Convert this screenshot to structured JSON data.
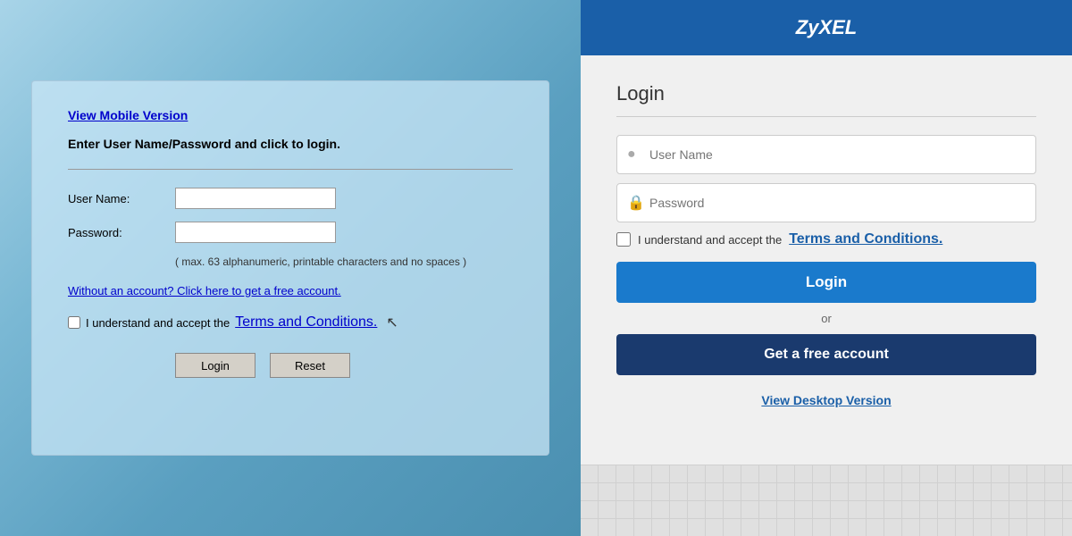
{
  "left": {
    "view_mobile_label": "View Mobile Version",
    "instruction": "Enter User Name/Password and click to login.",
    "username_label": "User Name:",
    "password_label": "Password:",
    "password_hint": "( max. 63 alphanumeric, printable characters and no spaces )",
    "free_account_link": "Without an account? Click here to get a free account.",
    "terms_text": "I understand and accept the ",
    "terms_link": "Terms and Conditions.",
    "login_btn": "Login",
    "reset_btn": "Reset"
  },
  "right": {
    "brand": "ZyXEL",
    "login_title": "Login",
    "username_placeholder": "User Name",
    "password_placeholder": "Password",
    "terms_text": "I understand and accept the ",
    "terms_link": "Terms and Conditions.",
    "login_btn": "Login",
    "or_text": "or",
    "free_account_btn": "Get a free account",
    "view_desktop": "View Desktop Version"
  }
}
